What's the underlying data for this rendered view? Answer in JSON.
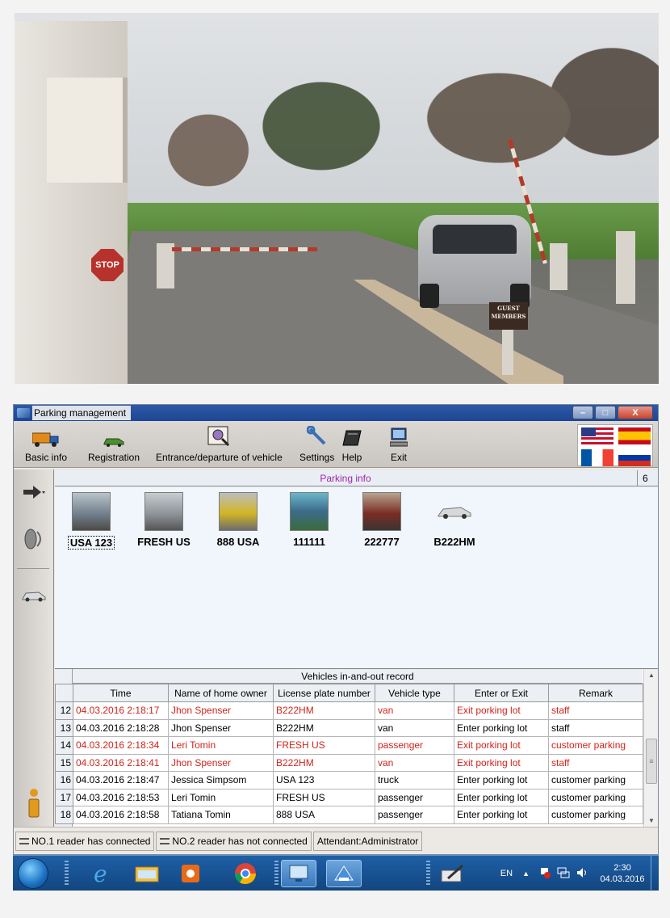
{
  "photo": {
    "stop_sign": "STOP",
    "guest_sign": [
      "GUEST",
      "MEMBERS"
    ]
  },
  "window": {
    "title": "Parking management",
    "buttons": {
      "minimize": "–",
      "maximize": "□",
      "close": "X"
    }
  },
  "toolbar": {
    "items": [
      {
        "label": "Basic info",
        "icon": "truck-icon"
      },
      {
        "label": "Registration",
        "icon": "car-icon"
      },
      {
        "label": "Entrance/departure of vehicle",
        "icon": "scan-icon"
      },
      {
        "label": "Settings",
        "icon": "wrench-icon"
      },
      {
        "label": "Help",
        "icon": "book-icon"
      },
      {
        "label": "Exit",
        "icon": "computer-icon"
      }
    ],
    "flags": [
      "us-flag",
      "es-flag",
      "fr-flag",
      "ru-flag"
    ]
  },
  "parking_info": {
    "title": "Parking info",
    "count": "6",
    "vehicles": [
      {
        "plate": "USA 123",
        "thumb": "#6d7b88"
      },
      {
        "plate": "FRESH US",
        "thumb": "#8a8f95"
      },
      {
        "plate": "888 USA",
        "thumb": "#d2b624"
      },
      {
        "plate": "111111",
        "thumb": "#3c6b8a"
      },
      {
        "plate": "222777",
        "thumb": "#7b2d25"
      },
      {
        "plate": "B222HM",
        "thumb": ""
      }
    ]
  },
  "record": {
    "caption": "Vehicles in-and-out record",
    "columns": [
      "Time",
      "Name of home owner",
      "License plate number",
      "Vehicle type",
      "Enter or Exit",
      "Remark"
    ],
    "rows": [
      {
        "n": "12",
        "time": "04.03.2016 2:18:17",
        "owner": "Jhon Spenser",
        "plate": "B222HM",
        "type": "van",
        "dir": "Exit porking lot",
        "remark": "staff",
        "red": true
      },
      {
        "n": "13",
        "time": "04.03.2016 2:18:28",
        "owner": "Jhon Spenser",
        "plate": "B222HM",
        "type": "van",
        "dir": "Enter porking lot",
        "remark": "staff",
        "red": false
      },
      {
        "n": "14",
        "time": "04.03.2016 2:18:34",
        "owner": "Leri Tomin",
        "plate": "FRESH US",
        "type": "passenger",
        "dir": "Exit porking lot",
        "remark": "customer parking",
        "red": true
      },
      {
        "n": "15",
        "time": "04.03.2016 2:18:41",
        "owner": "Jhon Spenser",
        "plate": "B222HM",
        "type": "van",
        "dir": "Exit porking lot",
        "remark": "staff",
        "red": true
      },
      {
        "n": "16",
        "time": "04.03.2016 2:18:47",
        "owner": "Jessica Simpsom",
        "plate": "USA 123",
        "type": "truck",
        "dir": "Enter porking lot",
        "remark": "customer parking",
        "red": false
      },
      {
        "n": "17",
        "time": "04.03.2016 2:18:53",
        "owner": "Leri Tomin",
        "plate": "FRESH US",
        "type": "passenger",
        "dir": "Enter porking lot",
        "remark": "customer parking",
        "red": false
      },
      {
        "n": "18",
        "time": "04.03.2016 2:18:58",
        "owner": "Tatiana Tomin",
        "plate": "888 USA",
        "type": "passenger",
        "dir": "Enter porking lot",
        "remark": "customer parking",
        "red": false
      }
    ]
  },
  "status": {
    "reader1": "NO.1 reader has connected",
    "reader2": "NO.2 reader has not connected",
    "attendant": "Attendant:Administrator"
  },
  "taskbar": {
    "lang": "EN",
    "time": "2:30",
    "date": "04.03.2016"
  },
  "colors": {
    "record_red": "#d0241b",
    "info_title": "#a126a8",
    "taskbar": "#1e5fa6"
  }
}
